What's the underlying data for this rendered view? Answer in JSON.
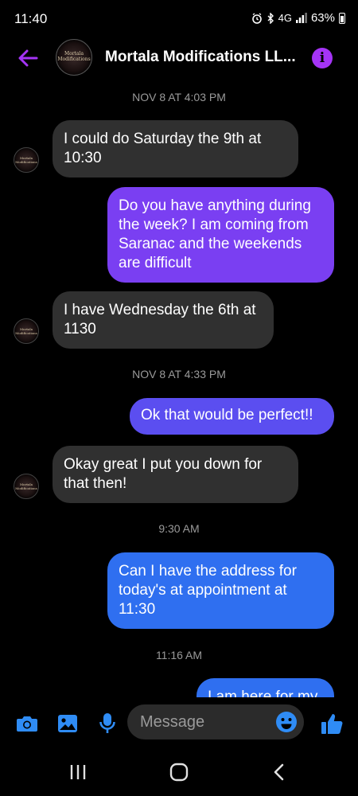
{
  "status_bar": {
    "time": "11:40",
    "network": "4G",
    "battery": "63%"
  },
  "header": {
    "contact_name": "Mortala Modifications LL...",
    "avatar_text": "Mortala Modifications",
    "info_icon": "i"
  },
  "colors": {
    "accent_purple": "#a534f6",
    "bubble_outgoing_purple": "#7a3ff2",
    "bubble_outgoing_indigo": "#5b4ef0",
    "bubble_outgoing_blue": "#2f6ff0",
    "bubble_incoming": "#303030"
  },
  "conversation": {
    "timestamps": [
      "NOV 8 AT 4:03 PM",
      "NOV 8 AT 4:33 PM",
      "9:30 AM",
      "11:16 AM"
    ],
    "messages": [
      {
        "direction": "incoming",
        "lines": [
          "I could do Saturday the 9th at",
          "10:30"
        ]
      },
      {
        "direction": "outgoing",
        "lines": [
          "Do you have anything during",
          "the week? I am coming from",
          "Saranac and the weekends",
          "are difficult"
        ]
      },
      {
        "direction": "incoming",
        "lines": [
          "I have Wednesday the 6th at",
          "1130"
        ]
      },
      {
        "direction": "outgoing",
        "lines": [
          "Ok that would be perfect!!"
        ]
      },
      {
        "direction": "incoming",
        "lines": [
          "Okay great I put you down for",
          "that then!"
        ]
      },
      {
        "direction": "outgoing",
        "lines": [
          "Can I have the address for",
          "today's at appointment at",
          "11:30"
        ]
      },
      {
        "direction": "outgoing",
        "lines": [
          "I am here for my"
        ]
      }
    ]
  },
  "composer": {
    "placeholder": "Message",
    "icons": [
      "camera-icon",
      "gallery-icon",
      "microphone-icon",
      "emoji-icon",
      "thumbs-up-icon"
    ]
  },
  "navbar": {
    "icons": [
      "recents-icon",
      "home-icon",
      "back-icon"
    ]
  }
}
